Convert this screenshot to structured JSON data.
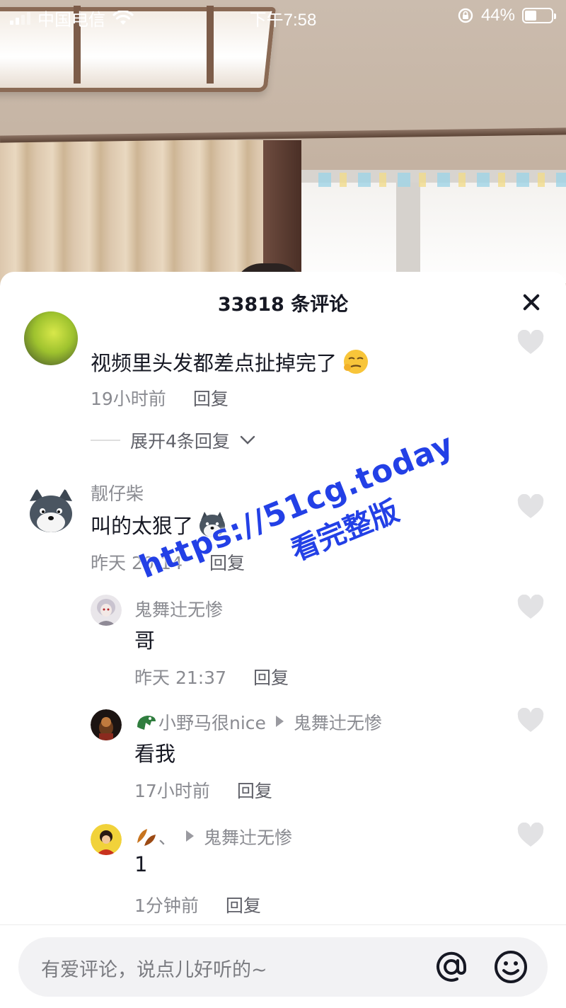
{
  "status_bar": {
    "carrier": "中国电信",
    "time": "下午7:58",
    "battery_percent": "44%",
    "battery_level": 0.44
  },
  "panel": {
    "title": "33818 条评论"
  },
  "comments": [
    {
      "username": "",
      "content": "视频里头发都差点扯掉完了",
      "time": "19小时前",
      "reply_label": "回复"
    },
    {
      "expand_label": "展开4条回复"
    },
    {
      "username": "靓仔柴",
      "content": "叫的太狠了",
      "time": "昨天 20:14",
      "reply_label": "回复"
    },
    {
      "username": "鬼舞辻无惨",
      "content": "哥",
      "time": "昨天 21:37",
      "reply_label": "回复"
    },
    {
      "username": "小野马很nice",
      "reply_to": "鬼舞辻无惨",
      "content": "看我",
      "time": "17小时前",
      "reply_label": "回复"
    },
    {
      "username": "、",
      "reply_to": "鬼舞辻无惨",
      "content": "1",
      "time": "1分钟前",
      "reply_label": "回复"
    }
  ],
  "input": {
    "placeholder": "有爱评论，说点儿好听的~"
  },
  "watermark": {
    "line1": "https://51cg.today",
    "line2": "看完整版"
  },
  "icons": [
    "wifi-icon",
    "lock-rotation-icon",
    "close-icon",
    "heart-icon",
    "at-icon",
    "emoji-icon",
    "chevron-down-icon",
    "reply-arrow-icon"
  ]
}
